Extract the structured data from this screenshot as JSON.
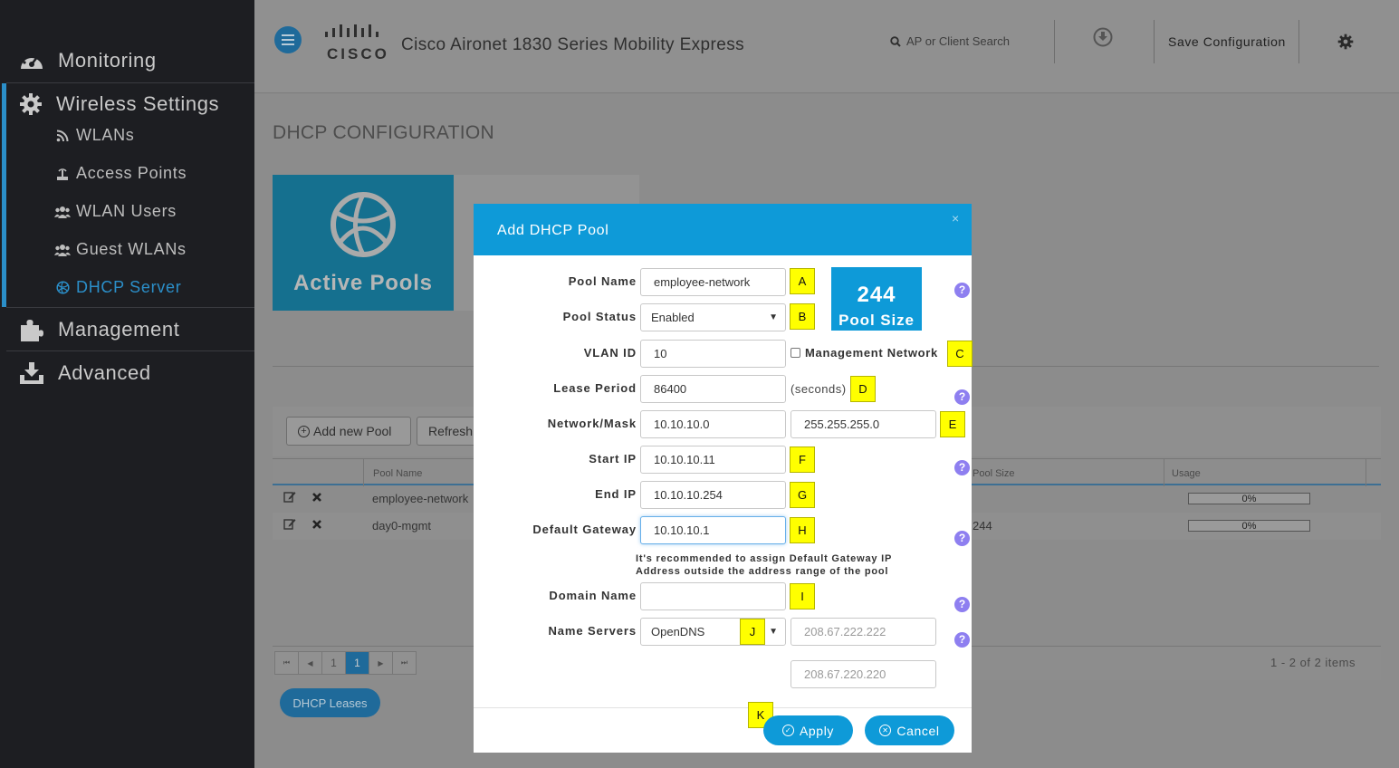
{
  "sidebar": {
    "monitoring": "Monitoring",
    "wireless_settings": "Wireless Settings",
    "items": [
      {
        "label": "WLANs"
      },
      {
        "label": "Access Points"
      },
      {
        "label": "WLAN Users"
      },
      {
        "label": "Guest WLANs"
      },
      {
        "label": "DHCP Server"
      }
    ],
    "management": "Management",
    "advanced": "Advanced",
    "accent_color": "#2b8fc9"
  },
  "header": {
    "logo_text": "CISCO",
    "title": "Cisco Aironet 1830 Series Mobility Express",
    "search_placeholder": "AP or Client Search",
    "save_label": "Save Configuration"
  },
  "content": {
    "page_title": "DHCP CONFIGURATION",
    "tile_label": "Active Pools",
    "add_pool_label": "Add new Pool",
    "refresh_label": "Refresh",
    "columns": {
      "pool_name": "Pool Name",
      "pool_size": "Pool Size",
      "usage": "Usage"
    },
    "rows": [
      {
        "pool_name": "employee-network",
        "pool_size": "",
        "usage": "0%"
      },
      {
        "pool_name": "day0-mgmt",
        "pool_size": "244",
        "usage": "0%"
      }
    ],
    "pager": {
      "first": "⏮",
      "prev": "◀",
      "page1": "1",
      "current": "1",
      "next": "▶",
      "last": "⏭"
    },
    "items_count": "1 - 2 of 2 items",
    "leases_label": "DHCP Leases"
  },
  "modal": {
    "title": "Add DHCP Pool",
    "close": "×",
    "labels": {
      "pool_name": "Pool Name",
      "pool_status": "Pool Status",
      "vlan_id": "VLAN ID",
      "lease_period": "Lease Period",
      "network_mask": "Network/Mask",
      "start_ip": "Start IP",
      "end_ip": "End IP",
      "default_gateway": "Default Gateway",
      "domain_name": "Domain Name",
      "name_servers": "Name Servers"
    },
    "values": {
      "pool_name": "employee-network",
      "pool_status": "Enabled",
      "vlan_id": "10",
      "lease_period": "86400",
      "network": "10.10.10.0",
      "mask": "255.255.255.0",
      "start_ip": "10.10.10.11",
      "end_ip": "10.10.10.254",
      "default_gateway": "10.10.10.1",
      "domain_name": "",
      "name_servers": "OpenDNS",
      "dns1": "208.67.222.222",
      "dns2": "208.67.220.220"
    },
    "pool_size_value": "244",
    "pool_size_label": "Pool Size",
    "management_network_label": "Management Network",
    "seconds_label": "(seconds)",
    "gateway_note_line1": "It's recommended to assign Default Gateway IP",
    "gateway_note_line2": "Address outside the address range of the pool",
    "apply_label": "Apply",
    "cancel_label": "Cancel",
    "help": "?",
    "accent_color": "#0e9ad8"
  },
  "callouts": [
    "A",
    "B",
    "C",
    "D",
    "E",
    "F",
    "G",
    "H",
    "I",
    "J",
    "K"
  ],
  "callout_color": "#ffff00"
}
